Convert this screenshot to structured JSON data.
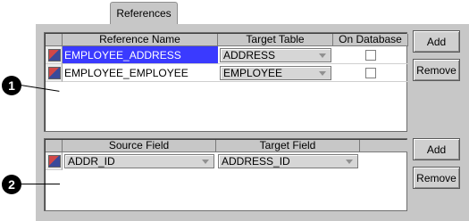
{
  "tab": {
    "label": "References"
  },
  "references_table": {
    "columns": [
      "Reference Name",
      "Target Table",
      "On Database"
    ],
    "rows": [
      {
        "name": "EMPLOYEE_ADDRESS",
        "target_table": "ADDRESS",
        "on_database": false,
        "selected": true
      },
      {
        "name": "EMPLOYEE_EMPLOYEE",
        "target_table": "EMPLOYEE",
        "on_database": false,
        "selected": false
      }
    ]
  },
  "references_buttons": {
    "add": "Add",
    "remove": "Remove"
  },
  "fields_table": {
    "columns": [
      "Source Field",
      "Target Field"
    ],
    "rows": [
      {
        "source_field": "ADDR_ID",
        "target_field": "ADDRESS_ID"
      }
    ]
  },
  "fields_buttons": {
    "add": "Add",
    "remove": "Remove"
  },
  "callouts": {
    "first": "1",
    "second": "2"
  },
  "colors": {
    "selection": "#3a3aff",
    "panel": "#c7c7c7"
  }
}
